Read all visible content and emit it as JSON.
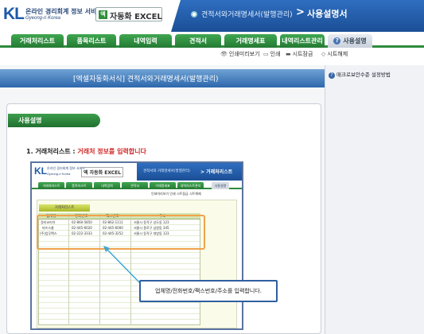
{
  "header": {
    "logo_text": "KL",
    "brand_line1": "온라인 경리회계 정보 서비스",
    "brand_line2": "Gyeong-ri Korea",
    "product_icon": "엑",
    "product_name": "자동화 EXCEL",
    "path": "견적서와거래명세서(발행관리)",
    "separator": ">",
    "page_title": "사용설명서"
  },
  "tabs": [
    {
      "label": "거래처리스트"
    },
    {
      "label": "품목리스트"
    },
    {
      "label": "내역입력"
    },
    {
      "label": "견적서"
    },
    {
      "label": "거래명세표"
    },
    {
      "label": "내역리스트관리"
    },
    {
      "label": "사용설명",
      "icon": "question-icon"
    }
  ],
  "toolbar": {
    "preview": "인쇄미리보기",
    "print": "인쇄",
    "sheet_protect": "시트잠금",
    "sheet_unprotect": "시트해제"
  },
  "banner": {
    "title": "[엑셀자동화서식] 견적서와거래명세서(발행관리)"
  },
  "sidebar": {
    "link": "매크로보안수준 설정방법"
  },
  "guide": {
    "pill": "사용설명",
    "section_num": "1. 거래처리스트 :",
    "section_desc": "거래처 정보를 입력합니다"
  },
  "mini": {
    "logo_text": "KL",
    "brand_line1": "온라인 경리회계 정보 서비스",
    "brand_line2": "Gyeong-ri Korea",
    "product": "엑 자동화 EXCEL",
    "path": "견적서와 거래명세서(발행관리)",
    "title": "> 거래처리스트",
    "tabs": [
      "거래처리스트",
      "품목리스트",
      "내역입력",
      "견적서",
      "거래명세표",
      "내역리스트관리",
      "사용설명"
    ],
    "tools": "인쇄미리보기  인쇄  시트잠금  시트해제",
    "button": "거래처리스트",
    "columns": [
      "업체명",
      "전화번호",
      "팩스번호",
      "주소"
    ],
    "rows": [
      [
        "경리코리아",
        "02-860-5850",
        "02-862-1111",
        "서울시 동작구 상도동 123"
      ],
      [
        "비즈스쿨",
        "02-445-6020",
        "02-445-6000",
        "서울시 종로구 삼청동 345"
      ],
      [
        "(주)업무팩스",
        "02-222-3333",
        "02-445-3252",
        "서울시 동작구 대방동 123"
      ]
    ]
  },
  "callout": {
    "text": "업체명/전화번호/팩스번호/주소를 입력합니다."
  }
}
